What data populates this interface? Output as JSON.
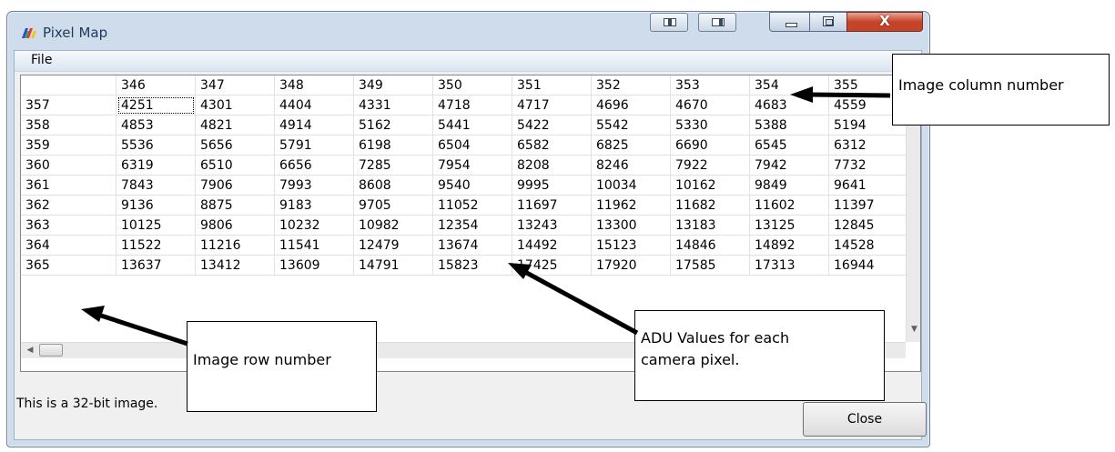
{
  "window": {
    "title": "Pixel Map",
    "close_glyph": "X"
  },
  "menu": {
    "file_label": "File"
  },
  "grid": {
    "columns": [
      "346",
      "347",
      "348",
      "349",
      "350",
      "351",
      "352",
      "353",
      "354",
      "355"
    ],
    "rows": [
      {
        "label": "357",
        "values": [
          "4251",
          "4301",
          "4404",
          "4331",
          "4718",
          "4717",
          "4696",
          "4670",
          "4683",
          "4559"
        ]
      },
      {
        "label": "358",
        "values": [
          "4853",
          "4821",
          "4914",
          "5162",
          "5441",
          "5422",
          "5542",
          "5330",
          "5388",
          "5194"
        ]
      },
      {
        "label": "359",
        "values": [
          "5536",
          "5656",
          "5791",
          "6198",
          "6504",
          "6582",
          "6825",
          "6690",
          "6545",
          "6312"
        ]
      },
      {
        "label": "360",
        "values": [
          "6319",
          "6510",
          "6656",
          "7285",
          "7954",
          "8208",
          "8246",
          "7922",
          "7942",
          "7732"
        ]
      },
      {
        "label": "361",
        "values": [
          "7843",
          "7906",
          "7993",
          "8608",
          "9540",
          "9995",
          "10034",
          "10162",
          "9849",
          "9641"
        ]
      },
      {
        "label": "362",
        "values": [
          "9136",
          "8875",
          "9183",
          "9705",
          "11052",
          "11697",
          "11962",
          "11682",
          "11602",
          "11397"
        ]
      },
      {
        "label": "363",
        "values": [
          "10125",
          "9806",
          "10232",
          "10982",
          "12354",
          "13243",
          "13300",
          "13183",
          "13125",
          "12845"
        ]
      },
      {
        "label": "364",
        "values": [
          "11522",
          "11216",
          "11541",
          "12479",
          "13674",
          "14492",
          "15123",
          "14846",
          "14892",
          "14528"
        ]
      },
      {
        "label": "365",
        "values": [
          "13637",
          "13412",
          "13609",
          "14791",
          "15823",
          "17425",
          "17920",
          "17585",
          "17313",
          "16944"
        ]
      }
    ]
  },
  "status_text": "This is a 32-bit image.",
  "close_button": "Close",
  "callouts": {
    "column": "Image column number",
    "row": "Image row number",
    "adu_line1": "ADU Values for each",
    "adu_line2": "camera pixel."
  }
}
